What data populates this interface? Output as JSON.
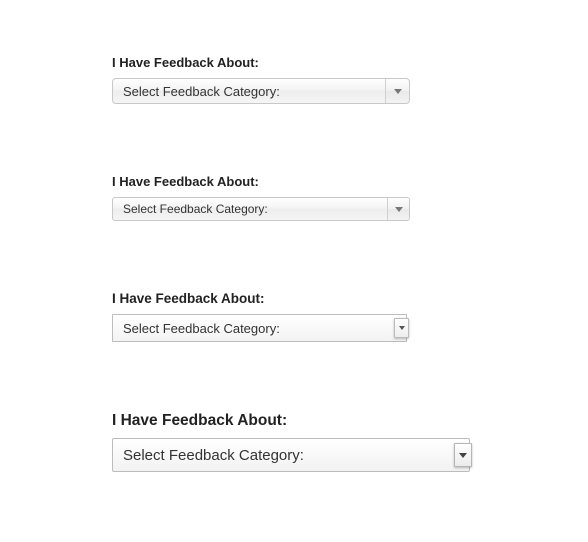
{
  "groups": [
    {
      "label": "I Have Feedback About:",
      "selected": "Select Feedback Category:"
    },
    {
      "label": "I Have Feedback About:",
      "selected": "Select Feedback Category:"
    },
    {
      "label": "I Have Feedback About:",
      "selected": "Select Feedback Category:"
    },
    {
      "label": "I Have Feedback About:",
      "selected": "Select Feedback Category:"
    }
  ]
}
